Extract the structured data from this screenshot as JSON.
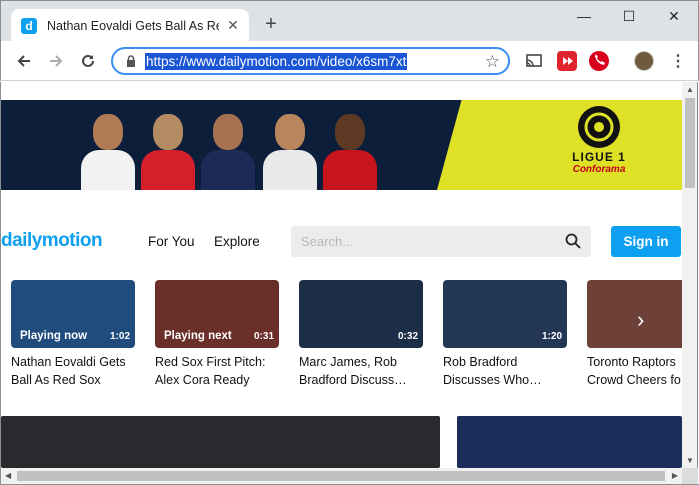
{
  "browser": {
    "tab": {
      "favicon_letter": "d",
      "title": "Nathan Eovaldi Gets Ball As Red Sox",
      "close_glyph": "✕"
    },
    "new_tab_glyph": "+",
    "window_controls": {
      "minimize": "—",
      "maximize": "☐",
      "close": "✕"
    },
    "url": "https://www.dailymotion.com/video/x6sm7xt",
    "colors": {
      "accent": "#1a55d6",
      "tabstrip": "#dee1e6"
    }
  },
  "site": {
    "logo": "dailymotion",
    "nav": [
      "For You",
      "Explore"
    ],
    "search_placeholder": "Search...",
    "signin_label": "Sign in",
    "accent": "#0d9ff0"
  },
  "banner": {
    "brand_line1": "LIGUE 1",
    "brand_line2": "Conforama"
  },
  "rail": {
    "items": [
      {
        "state": "Playing now",
        "duration": "1:02",
        "title": "Nathan Eovaldi Gets Ball As Red Sox Loo…",
        "thumb_color": "#1f4b7d"
      },
      {
        "state": "Playing next",
        "duration": "0:31",
        "title": "Red Sox First Pitch: Alex Cora Ready For…",
        "thumb_color": "#6b2f2a"
      },
      {
        "state": "",
        "duration": "0:32",
        "title": "Marc James, Rob Bradford Discuss…",
        "thumb_color": "#1c2d48"
      },
      {
        "state": "",
        "duration": "1:20",
        "title": "Rob Bradford Discusses Who…",
        "thumb_color": "#233654"
      },
      {
        "state": "",
        "duration": "",
        "title": "Toronto Raptors Crowd Cheers fo",
        "thumb_color": "#6d4038"
      }
    ],
    "next_icon": "›"
  }
}
